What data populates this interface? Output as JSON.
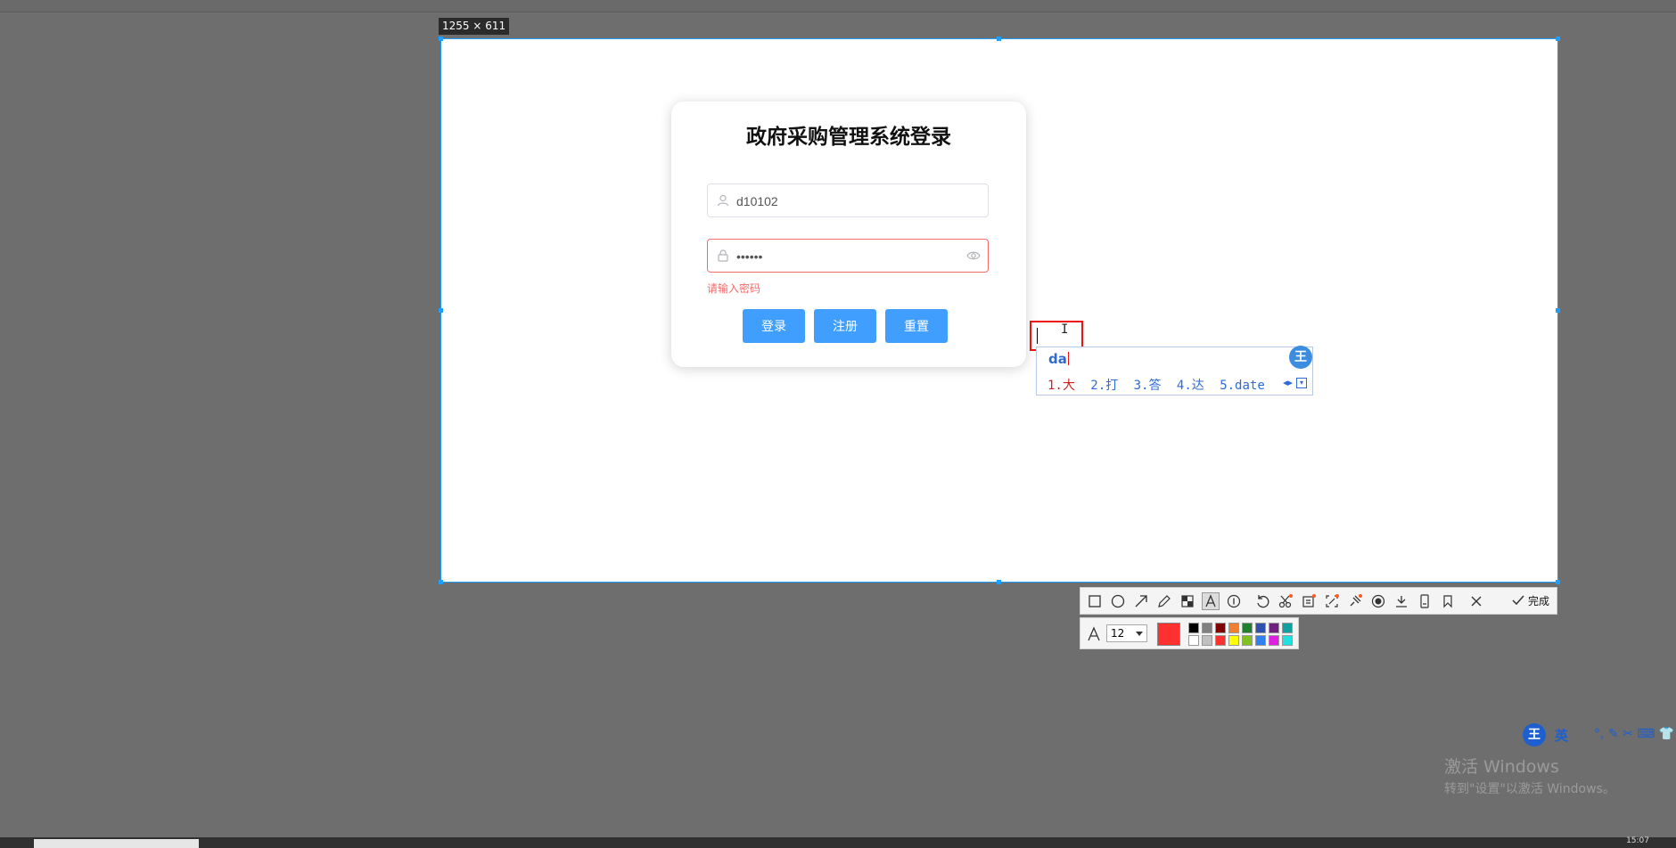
{
  "capture": {
    "size_label": "1255 × 611"
  },
  "login": {
    "title": "政府采购管理系统登录",
    "username_value": "d10102",
    "password_value": "••••••",
    "error_message": "请输入密码",
    "buttons": {
      "login": "登录",
      "register": "注册",
      "reset": "重置"
    }
  },
  "ime_popup": {
    "composition": "da",
    "logo": "王",
    "candidates": [
      "1.大",
      "2.打",
      "3.答",
      "4.达",
      "5.date"
    ]
  },
  "toolbar": {
    "icons": [
      "rectangle-icon",
      "ellipse-icon",
      "arrow-icon",
      "pencil-icon",
      "mosaic-icon",
      "text-icon",
      "number-icon",
      "undo-icon",
      "cut-icon",
      "ocr-icon",
      "scroll-capture-icon",
      "pin-icon",
      "record-icon",
      "download-icon",
      "save-icon",
      "bookmark-icon",
      "close-icon"
    ],
    "done_label": "完成",
    "font_size": "12",
    "current_color": "#ff3030",
    "palette": [
      "#000000",
      "#808080",
      "#800000",
      "#f08030",
      "#208030",
      "#3050b0",
      "#702080",
      "#10a0a0",
      "#ffffff",
      "#c0c0c0",
      "#ff3030",
      "#ffff00",
      "#80c020",
      "#3080f0",
      "#e020e0",
      "#20e0e0"
    ]
  },
  "ime_bar": {
    "logo": "王",
    "lang": "英",
    "tools": "°, ✎ ✂ ⌨ 👕"
  },
  "watermark": {
    "line1": "激活 Windows",
    "line2": "转到\"设置\"以激活 Windows。"
  },
  "taskbar": {
    "clock": "15:07"
  },
  "colors": {
    "accent": "#409eff",
    "error": "#f56c6c",
    "selection": "#1e9fff"
  }
}
